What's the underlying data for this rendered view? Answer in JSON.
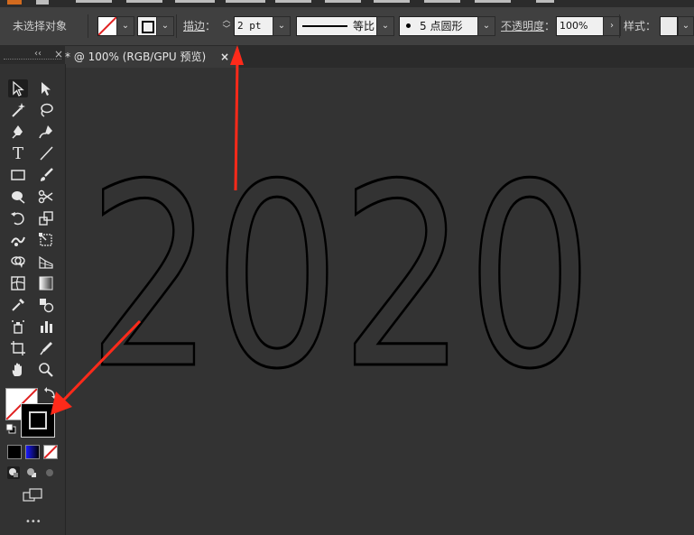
{
  "control_bar": {
    "selection_status": "未选择对象",
    "stroke_label": "描边",
    "stroke_weight": "2 pt",
    "profile_label": "等比",
    "brush_label": "5 点圆形",
    "opacity_label": "不透明度",
    "opacity_value": "100%",
    "style_label": "样式",
    "colon": "："
  },
  "document": {
    "tab_title": "* @ 100% (RGB/GPU 预览)",
    "close_glyph": "×"
  },
  "panel": {
    "collapse_glyph": "‹‹",
    "close_glyph": "×",
    "more_glyph": "•••"
  },
  "canvas": {
    "artwork_text": "2020"
  },
  "colors": {
    "annotation_arrow": "#ff2a1a",
    "canvas": "#333333",
    "control_bar": "#404040"
  },
  "tools": [
    "selection-tool",
    "direct-selection-tool",
    "magic-wand-tool",
    "lasso-tool",
    "pen-tool",
    "curvature-tool",
    "type-tool",
    "line-segment-tool",
    "rectangle-tool",
    "paintbrush-tool",
    "shaper-tool",
    "scissors-tool",
    "rotate-tool",
    "scale-tool",
    "warp-tool",
    "free-transform-tool",
    "shape-builder-tool",
    "perspective-grid-tool",
    "mesh-tool",
    "gradient-tool",
    "eyedropper-tool",
    "blend-tool",
    "symbol-sprayer-tool",
    "column-graph-tool",
    "artboard-tool",
    "slice-tool",
    "hand-tool",
    "zoom-tool"
  ]
}
